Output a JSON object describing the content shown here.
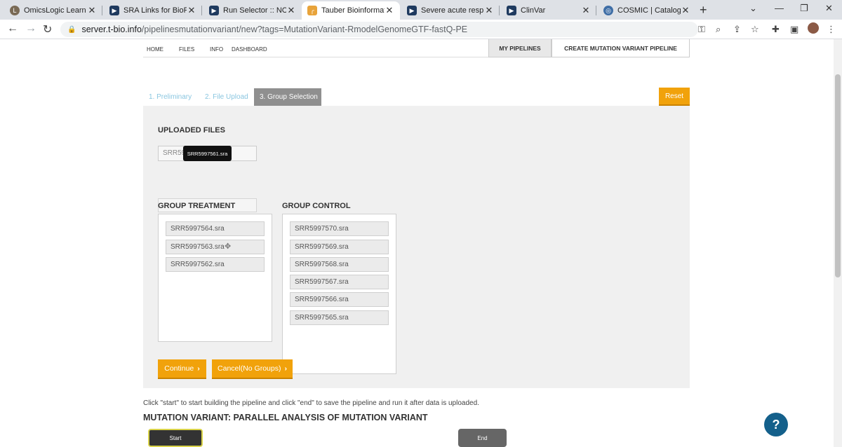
{
  "browser": {
    "tabs": [
      {
        "title": "OmicsLogic Learn - P",
        "icon": "omicslogic-icon",
        "color": "#7a6a55"
      },
      {
        "title": "SRA Links for BioProje",
        "icon": "ncbi-icon",
        "color": "#1f3a5f"
      },
      {
        "title": "Run Selector :: NCBI",
        "icon": "ncbi-icon",
        "color": "#1f3a5f"
      },
      {
        "title": "Tauber Bioinformatics",
        "icon": "tauber-icon",
        "color": "#e8a33a"
      },
      {
        "title": "Severe acute respirato",
        "icon": "ncbi-icon",
        "color": "#1f3a5f"
      },
      {
        "title": "ClinVar",
        "icon": "ncbi-icon",
        "color": "#1f3a5f"
      },
      {
        "title": "COSMIC | Catalogue o",
        "icon": "cosmic-icon",
        "color": "#3f6ea6"
      }
    ],
    "url_host": "server.t-bio.info",
    "url_path": "/pipelinesmutationvariant/new?tags=MutationVariant-RmodelGenomeGTF-fastQ-PE"
  },
  "nav": {
    "links": [
      "HOME",
      "FILES",
      "INFO",
      "DASHBOARD"
    ],
    "my_pipelines": "MY PIPELINES",
    "create": "CREATE MUTATION VARIANT PIPELINE"
  },
  "steps": [
    "1. Preliminary",
    "2. File Upload",
    "3. Group Selection"
  ],
  "reset_label": "Reset",
  "uploaded": {
    "title": "UPLOADED FILES",
    "box_text": "SRR59",
    "tooltip": "SRR5997561.sra"
  },
  "group_treatment": {
    "title": "GROUP TREATMENT",
    "files": [
      "SRR5997564.sra",
      "SRR5997563.sra",
      "SRR5997562.sra"
    ]
  },
  "group_control": {
    "title": "GROUP CONTROL",
    "files": [
      "SRR5997570.sra",
      "SRR5997569.sra",
      "SRR5997568.sra",
      "SRR5997567.sra",
      "SRR5997566.sra",
      "SRR5997565.sra"
    ]
  },
  "buttons": {
    "continue": "Continue",
    "cancel": "Cancel(No Groups)"
  },
  "hint": "Click \"start\" to start building the pipeline and click \"end\" to save the pipeline and run it after data is uploaded.",
  "pipeline_title": "MUTATION VARIANT: PARALLEL ANALYSIS OF MUTATION VARIANT",
  "nodes": {
    "start": "Start",
    "end": "End"
  },
  "colors": {
    "accent": "#f1a20b",
    "help": "#14608b",
    "step_active": "#8f8f8f",
    "step_link": "#8ac6e0"
  }
}
